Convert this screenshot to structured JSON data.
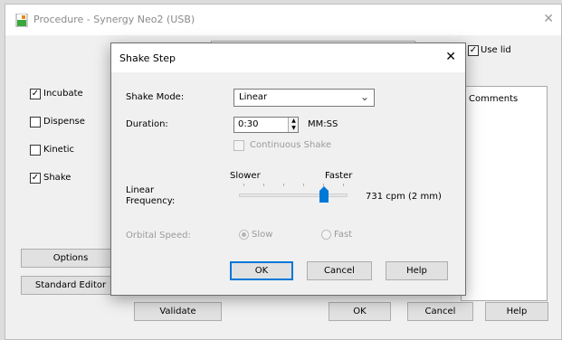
{
  "background_window": {
    "title": "Procedure - Synergy Neo2 (USB)",
    "use_lid_label": "Use lid",
    "use_lid_checked": true,
    "steps": [
      {
        "label": "Incubate",
        "checked": true
      },
      {
        "label": "Dispense",
        "checked": false
      },
      {
        "label": "Kinetic",
        "checked": false
      },
      {
        "label": "Shake",
        "checked": true
      }
    ],
    "comments_label": "Comments",
    "options_label": "Options",
    "standard_editor_label": "Standard Editor",
    "validate_label": "Validate",
    "ok_label": "OK",
    "cancel_label": "Cancel",
    "help_label": "Help"
  },
  "dialog": {
    "title": "Shake Step",
    "shake_mode_label": "Shake Mode:",
    "shake_mode_value": "Linear",
    "duration_label": "Duration:",
    "duration_value": "0:30",
    "duration_unit": "MM:SS",
    "continuous_shake_label": "Continuous Shake",
    "continuous_shake_checked": false,
    "linear_frequency_label_1": "Linear",
    "linear_frequency_label_2": "Frequency:",
    "slider_min_label": "Slower",
    "slider_max_label": "Faster",
    "slider_position": 0.78,
    "frequency_readout": "731 cpm (2 mm)",
    "orbital_speed_label": "Orbital Speed:",
    "orbital_slow_label": "Slow",
    "orbital_fast_label": "Fast",
    "orbital_selected": "Slow",
    "ok_label": "OK",
    "cancel_label": "Cancel",
    "help_label": "Help"
  },
  "colors": {
    "accent": "#0078d7",
    "icon_green": "#3aa83a",
    "icon_orange": "#e58a1c"
  }
}
